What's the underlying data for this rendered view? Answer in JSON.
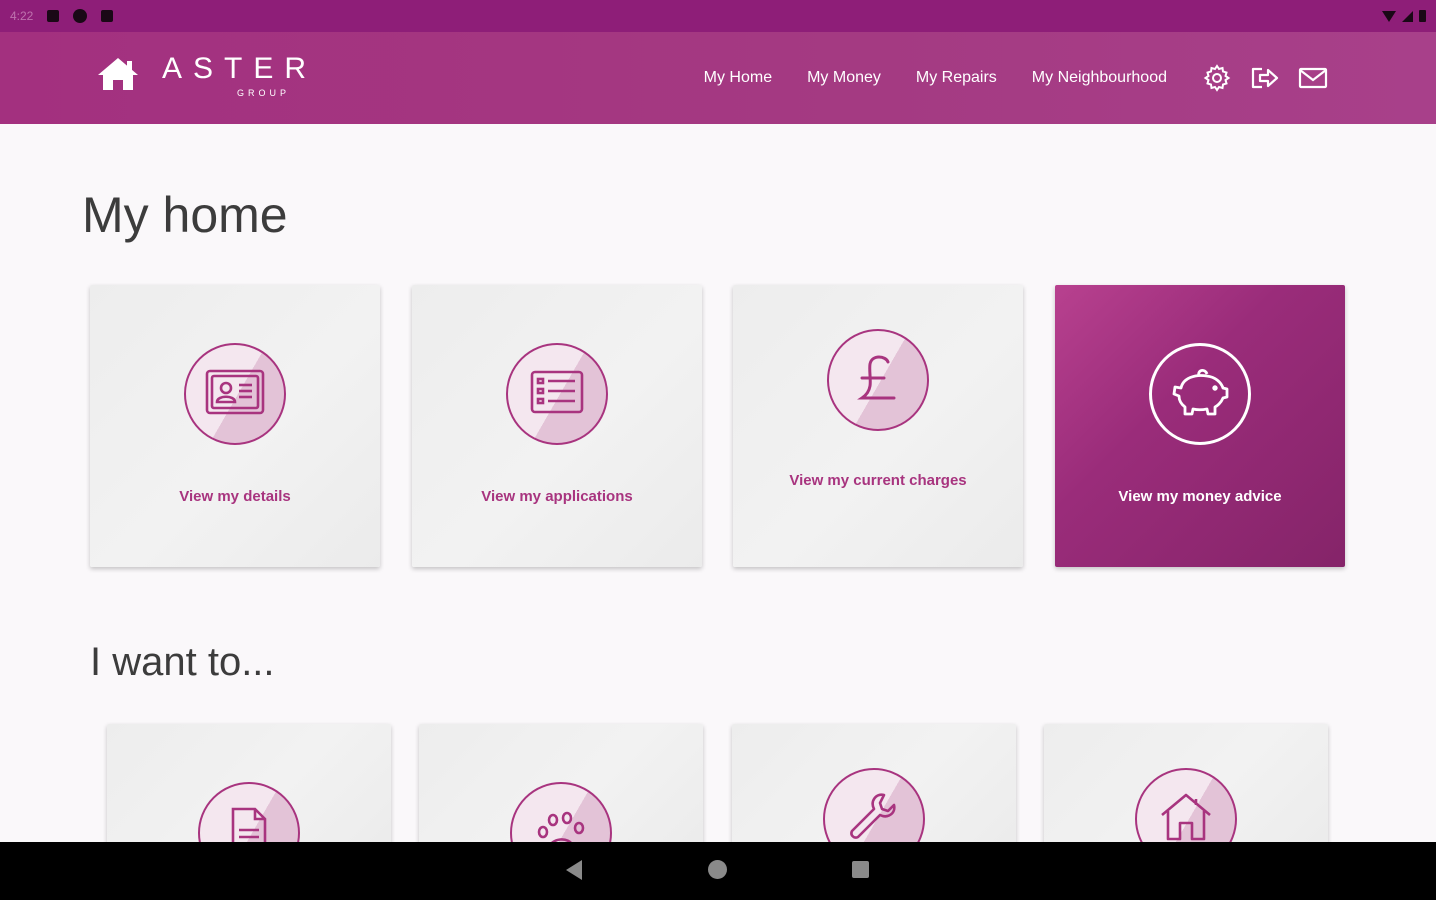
{
  "status_bar": {
    "time": "4:22"
  },
  "brand": {
    "name": "ASTER",
    "sub": "GROUP",
    "logo_icon": "house-icon"
  },
  "nav": {
    "links": [
      {
        "label": "My Home"
      },
      {
        "label": "My Money"
      },
      {
        "label": "My Repairs"
      },
      {
        "label": "My Neighbourhood"
      }
    ],
    "icons": [
      "settings-gear-icon",
      "logout-icon",
      "mail-icon"
    ]
  },
  "page": {
    "title": "My home"
  },
  "home_cards": [
    {
      "label": "View my details",
      "icon": "id-card-icon"
    },
    {
      "label": "View my applications",
      "icon": "list-icon"
    },
    {
      "label": "View my current charges",
      "icon": "pound-icon"
    },
    {
      "label": "View my money advice",
      "icon": "piggy-bank-icon",
      "active": true
    }
  ],
  "section": {
    "title": "I want to..."
  },
  "want_cards": [
    {
      "icon": "document-icon"
    },
    {
      "icon": "paw-icon"
    },
    {
      "icon": "wrench-icon"
    },
    {
      "icon": "house-outline-icon"
    }
  ],
  "colors": {
    "brand": "#a3307f",
    "accent": "#a8347f",
    "status_bar": "#8e1e78"
  }
}
